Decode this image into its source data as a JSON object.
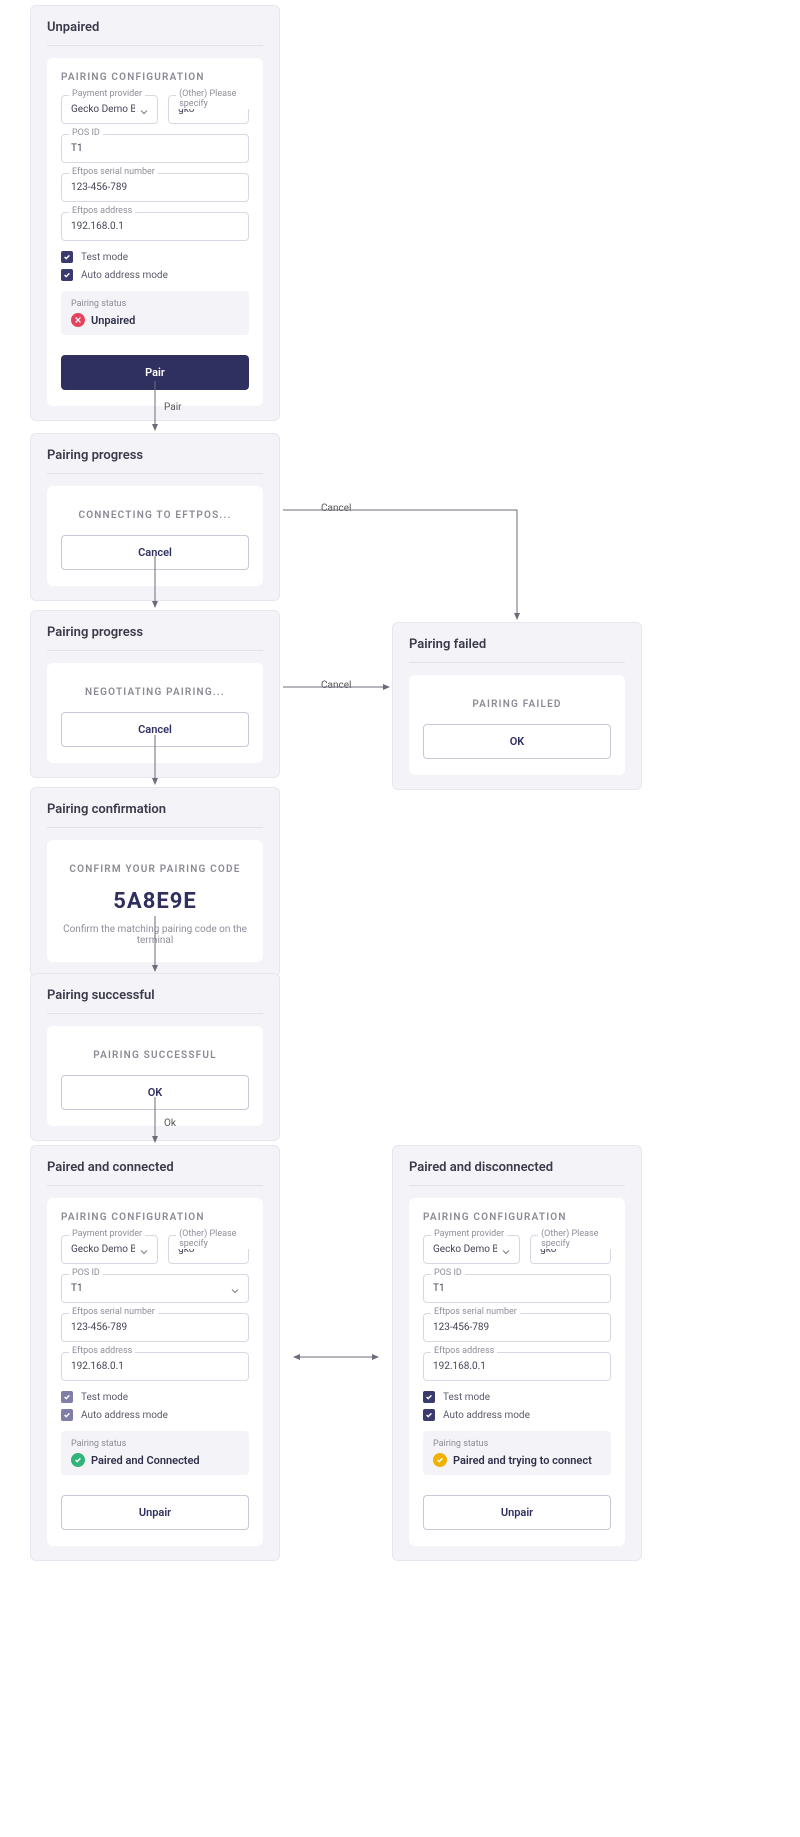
{
  "labels": {
    "pairing_configuration": "PAIRING CONFIGURATION",
    "payment_provider": "Payment provider",
    "other_specify": "(Other) Please specify",
    "pos_id": "POS ID",
    "eftpos_serial": "Eftpos serial number",
    "eftpos_address": "Eftpos address",
    "test_mode": "Test mode",
    "auto_address_mode": "Auto address mode",
    "pairing_status": "Pairing status"
  },
  "values": {
    "provider": "Gecko Demo Bank",
    "other": "gko",
    "pos_id": "T1",
    "serial": "123-456-789",
    "address": "192.168.0.1"
  },
  "panels": {
    "unpaired": {
      "title": "Unpaired",
      "status": "Unpaired",
      "action": "Pair"
    },
    "progress1": {
      "title": "Pairing progress",
      "msg": "CONNECTING TO EFTPOS...",
      "action": "Cancel"
    },
    "progress2": {
      "title": "Pairing progress",
      "msg": "NEGOTIATING PAIRING...",
      "action": "Cancel"
    },
    "failed": {
      "title": "Pairing failed",
      "msg": "PAIRING FAILED",
      "action": "OK"
    },
    "confirm": {
      "title": "Pairing confirmation",
      "msg": "CONFIRM YOUR PAIRING CODE",
      "code": "5A8E9E",
      "help": "Confirm the matching pairing code on the terminal"
    },
    "successful": {
      "title": "Pairing successful",
      "msg": "PAIRING SUCCESSFUL",
      "action": "OK"
    },
    "connected": {
      "title": "Paired and connected",
      "status": "Paired and Connected",
      "action": "Unpair"
    },
    "disconnected": {
      "title": "Paired and disconnected",
      "status": "Paired and trying to connect",
      "action": "Unpair"
    }
  },
  "edges": {
    "pair": "Pair",
    "cancel": "Cancel",
    "ok": "Ok"
  },
  "colors": {
    "red": "#e4435c",
    "green": "#30b47a",
    "yellow": "#f2b100",
    "primary": "#303060"
  }
}
